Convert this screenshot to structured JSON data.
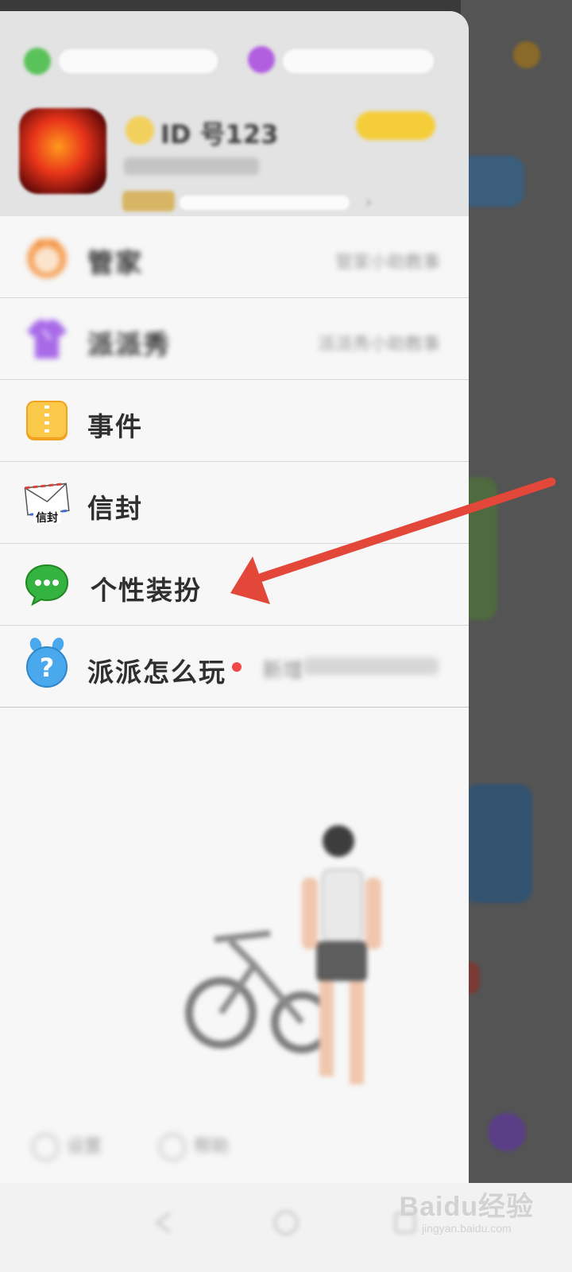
{
  "drawer": {
    "nickname": "ID 号123",
    "menu": [
      {
        "label": "管家",
        "right_text": "管家小助教事",
        "icon": "butler-icon",
        "blurred": true
      },
      {
        "label": "派派秀",
        "right_text": "派派秀小助教事",
        "icon": "tshirt-icon",
        "blurred": true
      },
      {
        "label": "事件",
        "right_text": "",
        "icon": "event-book-icon",
        "blurred": false
      },
      {
        "label": "信封",
        "right_text": "",
        "icon": "envelope-icon",
        "blurred": false
      },
      {
        "label": "个性装扮",
        "right_text": "",
        "icon": "chat-bubble-icon",
        "blurred": false
      },
      {
        "label": "派派怎么玩",
        "right_text": "新增",
        "icon": "help-question-icon",
        "blurred": false
      }
    ],
    "envelope_icon_text": "信封",
    "bottom": {
      "settings": "设置",
      "help": "帮助"
    }
  },
  "watermark": {
    "main": "Baidu经验",
    "sub": "jingyan.baidu.com"
  },
  "colors": {
    "annotation_arrow": "#e2473a",
    "menu_label": "#2f2f2f",
    "new_dot": "#f04848"
  }
}
